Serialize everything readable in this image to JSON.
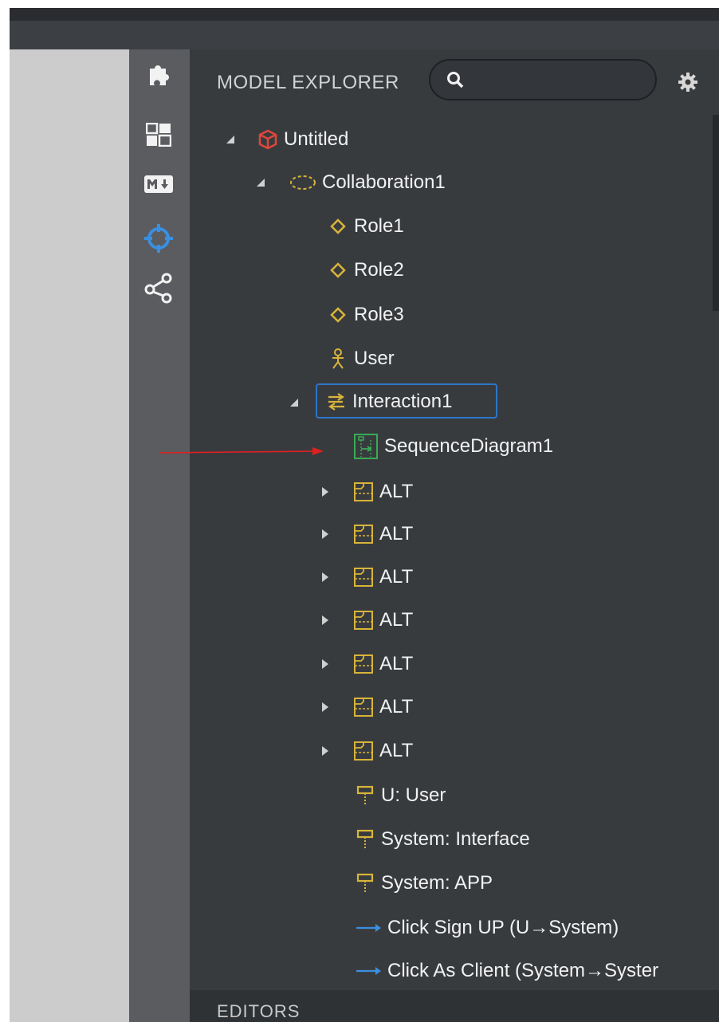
{
  "colors": {
    "panel_bg": "#383b3e",
    "toolbar_bg": "#5a5c60",
    "canvas_bg": "#cccccc",
    "accent_blue": "#2d76c8",
    "model_red": "#e0463a",
    "uml_yellow": "#d8b43a",
    "diagram_green": "#3aaa55",
    "message_blue": "#3a8fe0",
    "annotation_red": "#e02020"
  },
  "toolbar": {
    "items": [
      {
        "icon": "puzzle-icon"
      },
      {
        "icon": "layout-grid-icon"
      },
      {
        "icon": "markdown-icon",
        "label": "M↓"
      },
      {
        "icon": "crosshair-icon"
      },
      {
        "icon": "share-icon"
      }
    ]
  },
  "explorer": {
    "title": "MODEL EXPLORER",
    "search_placeholder": "",
    "search_value": "",
    "tree": {
      "root": "Untitled",
      "collaboration": "Collaboration1",
      "roles": [
        "Role1",
        "Role2",
        "Role3"
      ],
      "actor": "User",
      "interaction": "Interaction1",
      "diagram": "SequenceDiagram1",
      "fragments": [
        "ALT",
        "ALT",
        "ALT",
        "ALT",
        "ALT",
        "ALT",
        "ALT"
      ],
      "lifelines": [
        "U: User",
        "System: Interface",
        "System: APP"
      ],
      "messages": [
        "Click Sign UP (U→System)",
        "Click As Client (System→Syster"
      ]
    }
  },
  "editors": {
    "label": "EDITORS"
  }
}
